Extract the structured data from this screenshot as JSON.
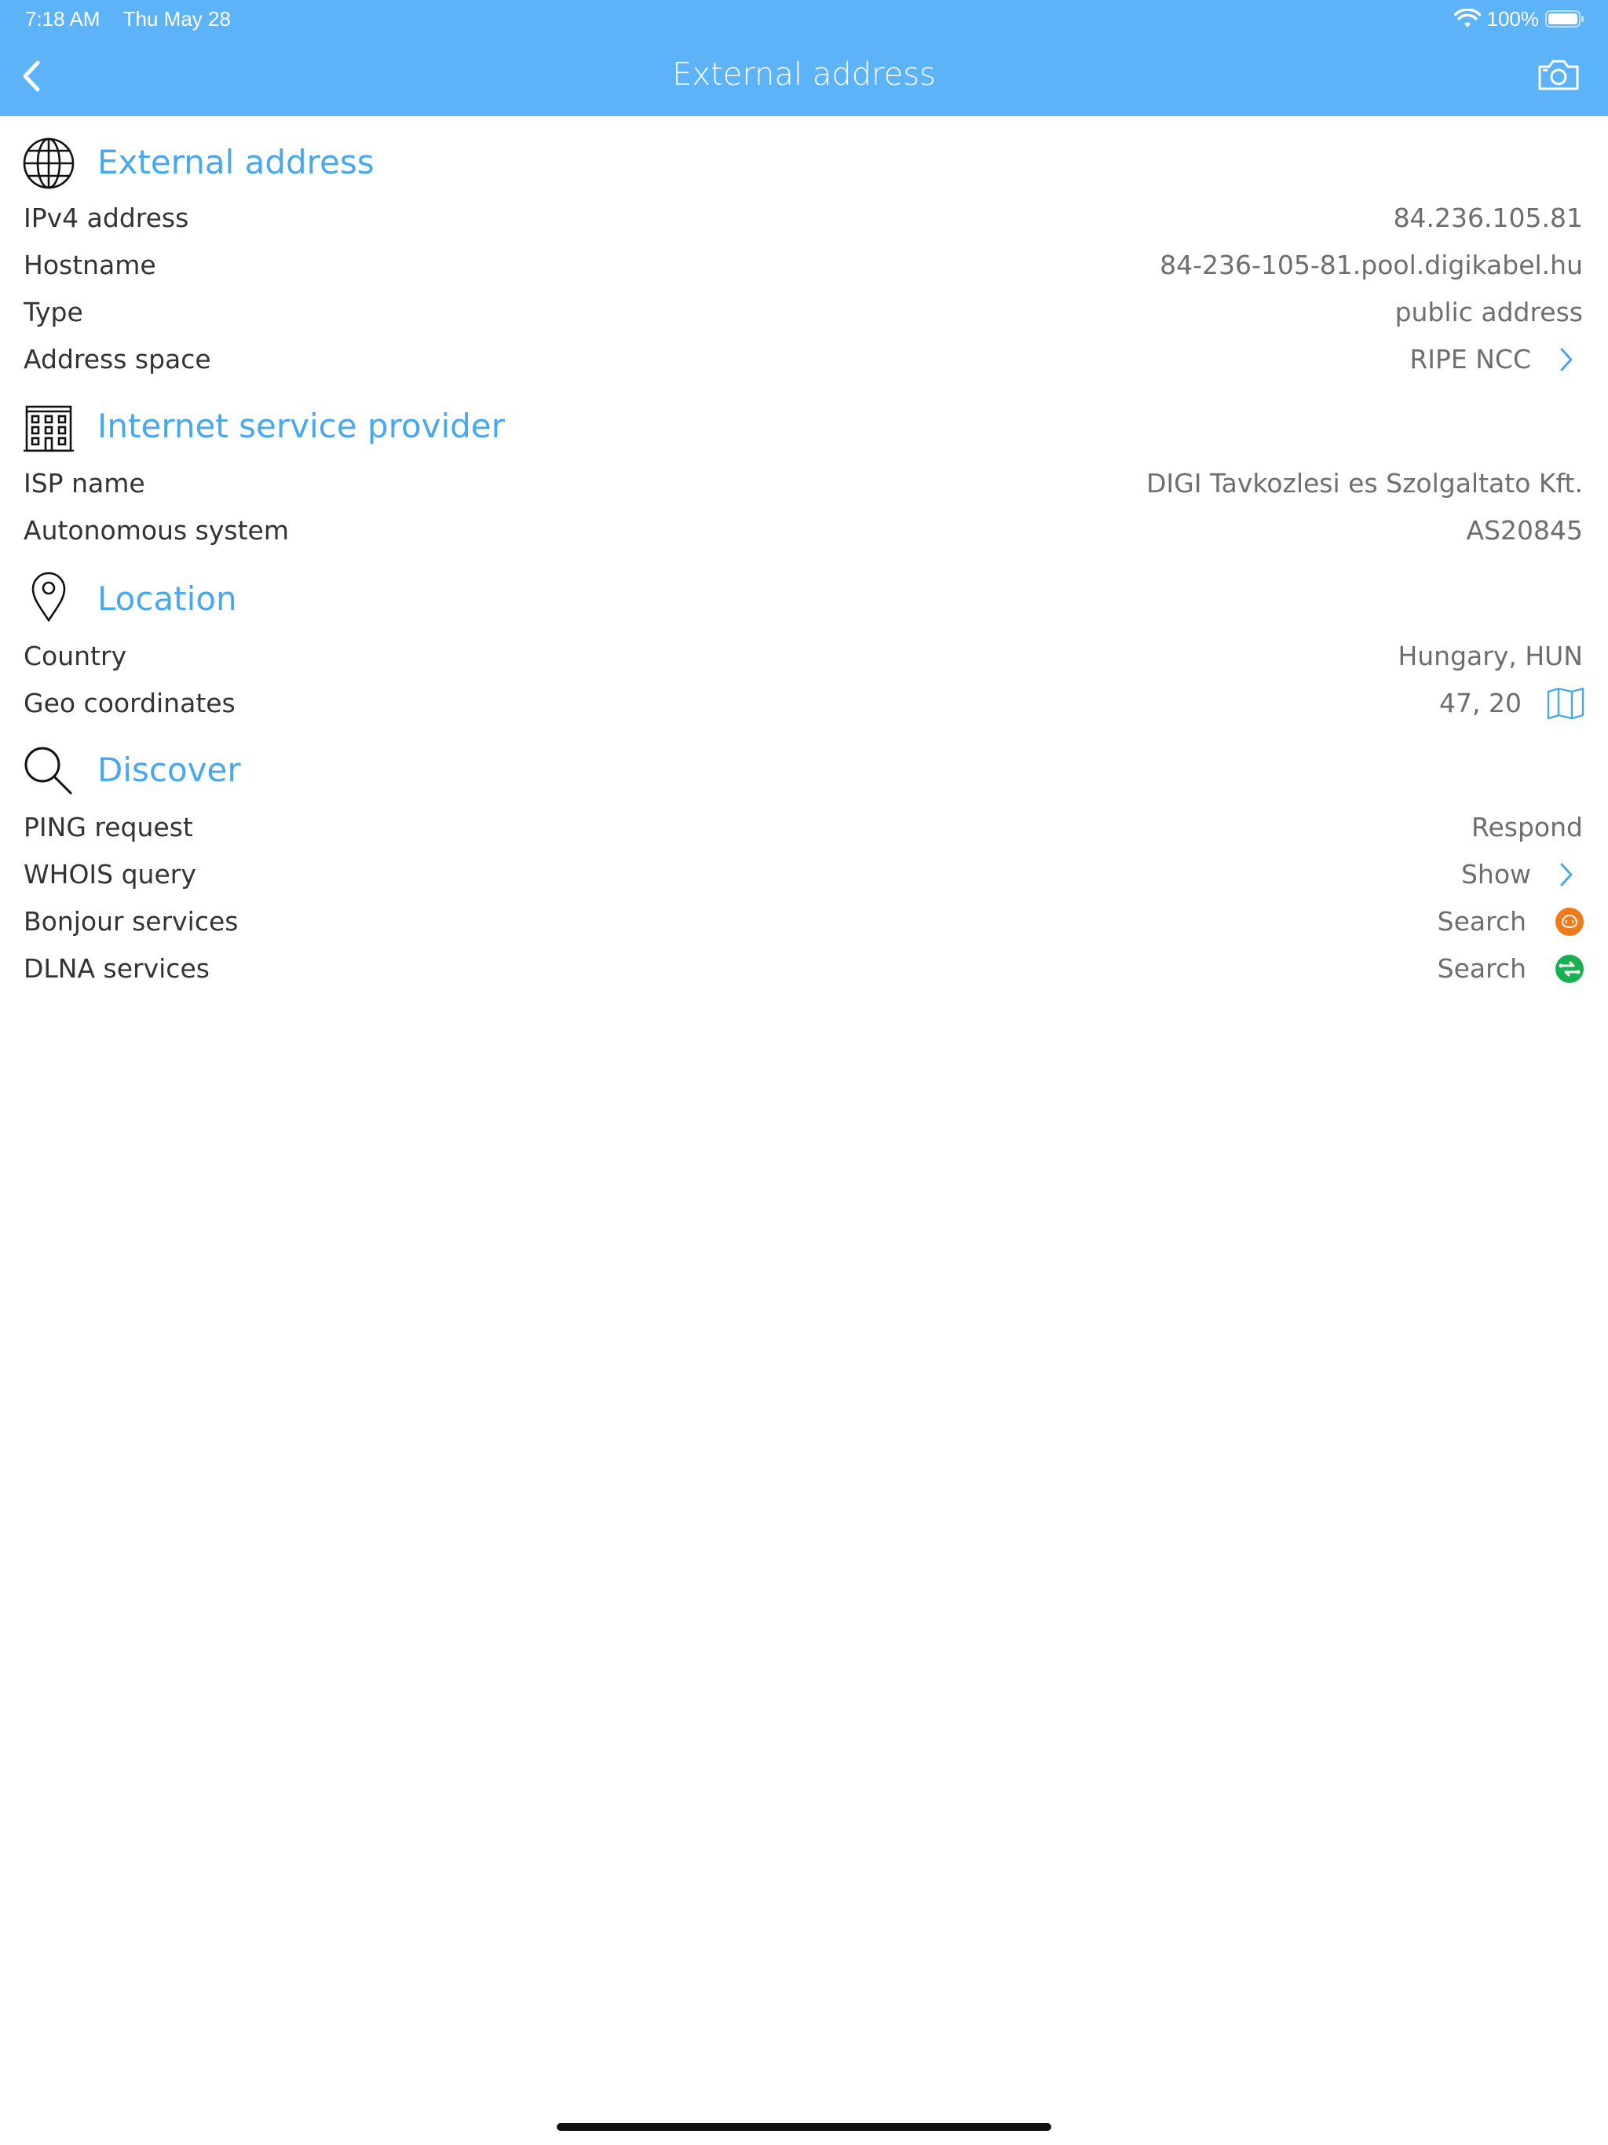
{
  "status_bar": {
    "time": "7:18 AM",
    "date": "Thu May 28",
    "battery": "100%",
    "wifi_icon": "wifi-icon",
    "battery_icon": "battery-icon"
  },
  "nav": {
    "back_icon": "chevron-left-icon",
    "title": "External address",
    "camera_icon": "camera-icon"
  },
  "colors": {
    "header_bg": "#5cb3f7",
    "accent": "#48a8ea",
    "bonjour_orange": "#f07a1a",
    "dlna_green": "#19b04f"
  },
  "sections": {
    "external": {
      "title": "External address",
      "icon": "globe-icon",
      "rows": {
        "ipv4": {
          "label": "IPv4 address",
          "value": "84.236.105.81"
        },
        "hostname": {
          "label": "Hostname",
          "value": "84-236-105-81.pool.digikabel.hu"
        },
        "type": {
          "label": "Type",
          "value": "public address"
        },
        "space": {
          "label": "Address space",
          "value": "RIPE NCC",
          "icon": "chevron-right-icon"
        }
      }
    },
    "isp": {
      "title": "Internet service provider",
      "icon": "building-icon",
      "rows": {
        "name": {
          "label": "ISP name",
          "value": "DIGI Tavkozlesi es Szolgaltato Kft."
        },
        "as": {
          "label": "Autonomous system",
          "value": "AS20845"
        }
      }
    },
    "location": {
      "title": "Location",
      "icon": "map-pin-icon",
      "rows": {
        "country": {
          "label": "Country",
          "value": "Hungary, HUN"
        },
        "geo": {
          "label": "Geo coordinates",
          "value": "47, 20",
          "icon": "map-icon"
        }
      }
    },
    "discover": {
      "title": "Discover",
      "icon": "search-icon",
      "rows": {
        "ping": {
          "label": "PING request",
          "value": "Respond"
        },
        "whois": {
          "label": "WHOIS query",
          "value": "Show",
          "icon": "chevron-right-icon"
        },
        "bonjour": {
          "label": "Bonjour services",
          "value": "Search",
          "icon": "bonjour-icon"
        },
        "dlna": {
          "label": "DLNA services",
          "value": "Search",
          "icon": "dlna-icon"
        }
      }
    }
  }
}
